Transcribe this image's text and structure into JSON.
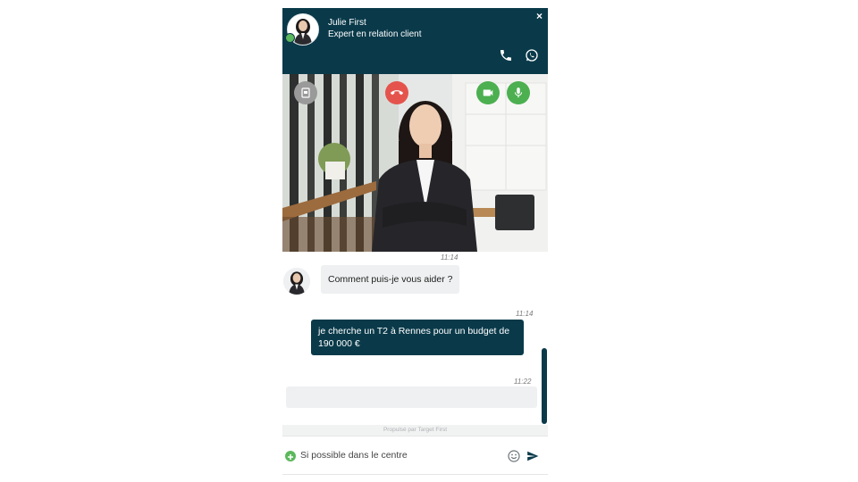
{
  "header": {
    "agent_name": "Julie First",
    "agent_title": "Expert en relation client",
    "close_label": "×",
    "status_color": "#5cb85c",
    "icons": [
      "phone-icon",
      "whatsapp-icon"
    ]
  },
  "video_controls": {
    "icons": [
      "screen-share-icon",
      "hang-up-icon",
      "camera-icon",
      "microphone-icon"
    ],
    "colors": {
      "neutral": "#9a9a9a",
      "hangup": "#e4544c",
      "active": "#4caf50"
    }
  },
  "messages": [
    {
      "from": "agent",
      "time": "11:14",
      "text": "Comment puis-je vous aider ?"
    },
    {
      "from": "visitor",
      "time": "11:14",
      "text": "je cherche un T2 à Rennes pour un budget de 190 000 €"
    },
    {
      "from": "visitor",
      "time": "11:22",
      "text": ""
    }
  ],
  "powered_by": "Propulsé par Target First",
  "composer": {
    "value": "Si possible dans le centre",
    "icons": [
      "add-icon",
      "emoji-icon",
      "send-icon"
    ]
  },
  "colors": {
    "brand": "#0a3a4a",
    "bubble_in": "#eef0f1"
  }
}
